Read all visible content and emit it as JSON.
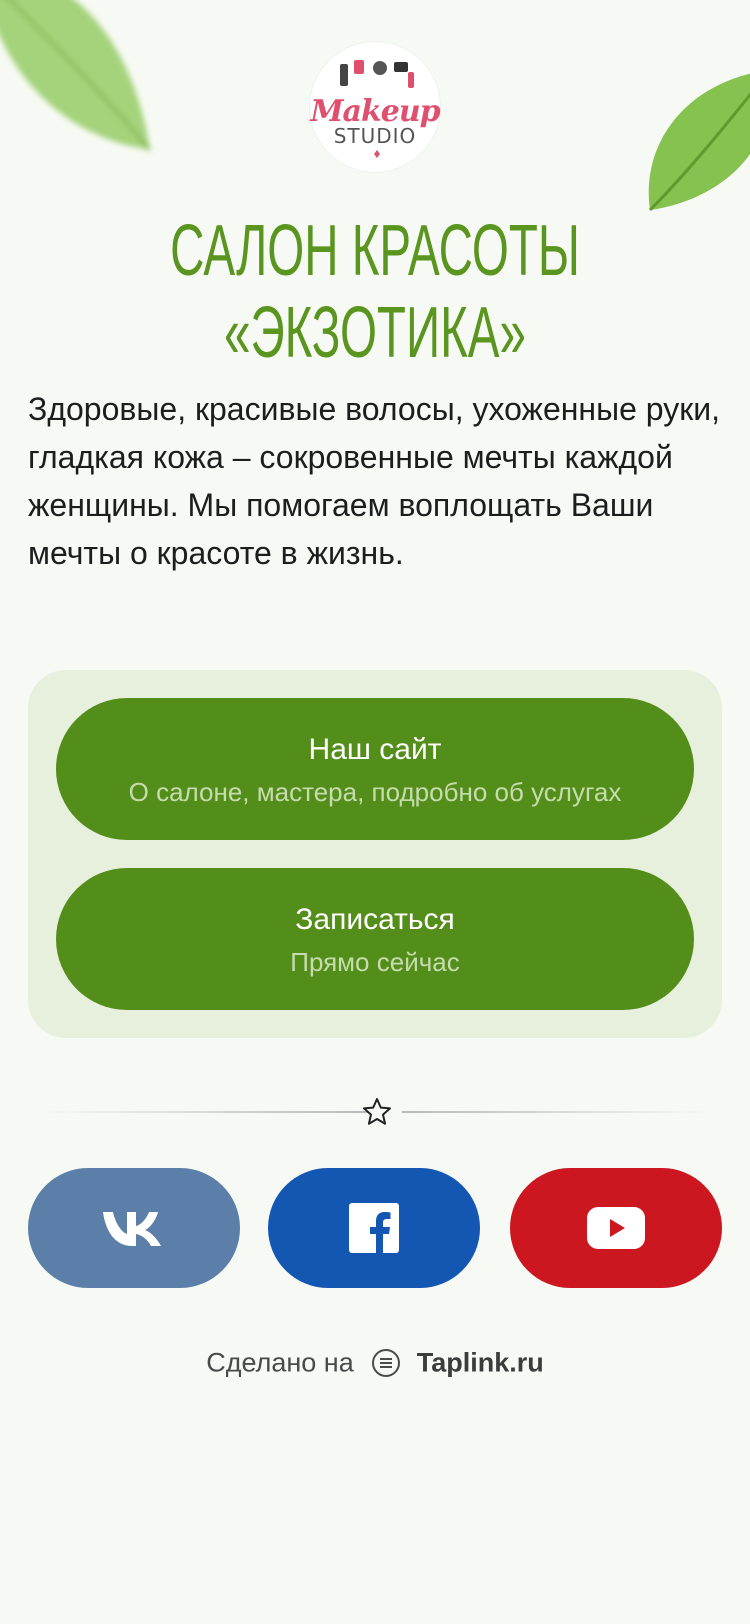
{
  "logo": {
    "script_text": "Makeup",
    "studio_text": "STUDIO"
  },
  "title": {
    "line1": "САЛОН КРАСОТЫ",
    "line2": "«ЭКЗОТИКА»"
  },
  "description": "Здоровые, красивые волосы, ухоженные руки, гладкая кожа – сокровенные мечты каждой женщины. Мы помогаем воплощать Ваши мечты о красоте в жизнь.",
  "buttons": [
    {
      "title": "Наш сайт",
      "subtitle": "О салоне, мастера, подробно об услугах"
    },
    {
      "title": "Записаться",
      "subtitle": "Прямо сейчас"
    }
  ],
  "divider": {
    "icon": "star-icon"
  },
  "socials": [
    {
      "name": "vk-icon",
      "color": "#5b7fa8"
    },
    {
      "name": "facebook-icon",
      "color": "#1457b3"
    },
    {
      "name": "youtube-icon",
      "color": "#cc1720"
    }
  ],
  "footer": {
    "made_text": "Сделано на",
    "brand": "Taplink.ru"
  },
  "colors": {
    "accent": "#548e1a",
    "title": "#5a9520",
    "panel": "#e7f0dd",
    "background": "#f7faf4"
  }
}
